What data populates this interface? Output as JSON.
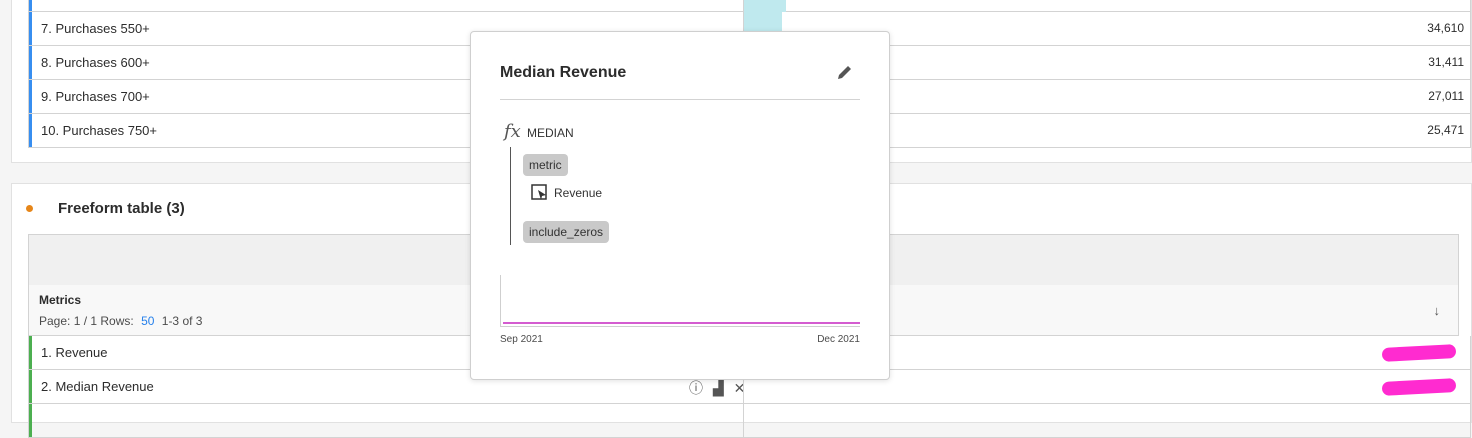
{
  "table1": {
    "rows": [
      {
        "label": "7. Purchases 550+",
        "value": "34,610"
      },
      {
        "label": "8. Purchases 600+",
        "value": "31,411"
      },
      {
        "label": "9. Purchases 700+",
        "value": "27,011"
      },
      {
        "label": "10. Purchases 750+",
        "value": "25,471"
      }
    ]
  },
  "table2": {
    "title": "Freeform table (3)",
    "metrics_label": "Metrics",
    "pager_prefix": "Page: 1 / 1 Rows:",
    "rows_value": "50",
    "range": "1-3 of 3",
    "sort_icon": "↓",
    "rows": [
      {
        "label": "1. Revenue"
      },
      {
        "label": "2. Median Revenue"
      }
    ]
  },
  "popup": {
    "title": "Median Revenue",
    "function_icon": "fx",
    "function_name": "MEDIAN",
    "arg1": "metric",
    "metric_ref": "Revenue",
    "arg2": "include_zeros",
    "chart_start": "Sep 2021",
    "chart_end": "Dec 2021"
  },
  "icons": {
    "info": "ⓘ",
    "breakdown": "▟",
    "close": "✕"
  },
  "colors": {
    "accent_blue": "#378ef0",
    "accent_green": "#4caf50",
    "orange": "#e68619",
    "sparkline": "#d45cd0",
    "bar_fill": "#bfe9ee"
  }
}
